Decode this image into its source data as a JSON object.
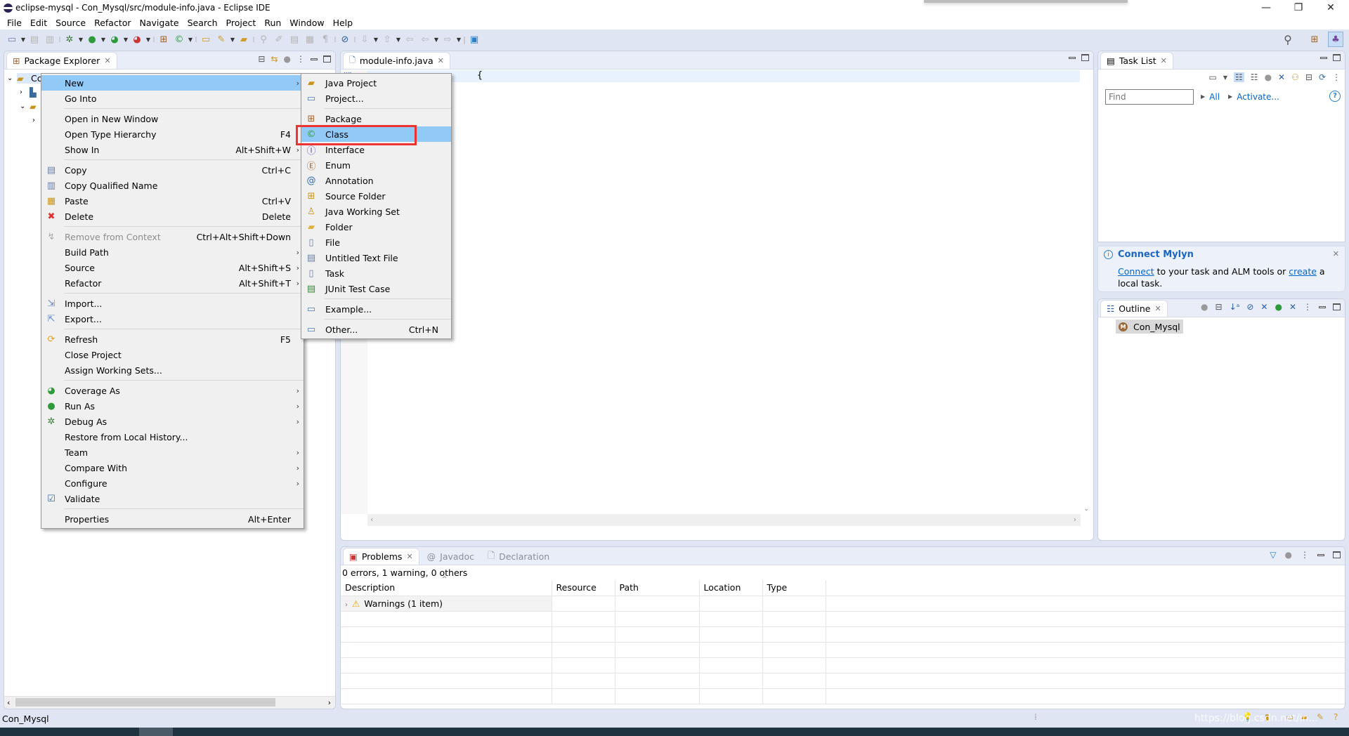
{
  "window": {
    "title": "eclipse-mysql - Con_Mysql/src/module-info.java - Eclipse IDE",
    "controls": {
      "minimize": "—",
      "restore": "❐",
      "close": "✕"
    }
  },
  "menubar": [
    "File",
    "Edit",
    "Source",
    "Refactor",
    "Navigate",
    "Search",
    "Project",
    "Run",
    "Window",
    "Help"
  ],
  "package_explorer": {
    "tab_label": "Package Explorer",
    "project_name_partial": "Cc",
    "tree": [
      {
        "name": "Cc",
        "icon": "java-project-icon",
        "expanded": true,
        "level": 0
      },
      {
        "name": "",
        "icon": "jre-library-icon",
        "expanded": false,
        "level": 1
      },
      {
        "name": "",
        "icon": "source-folder-icon",
        "expanded": true,
        "level": 1
      },
      {
        "name": "",
        "icon": "package-icon",
        "expanded": false,
        "level": 2
      }
    ]
  },
  "context_menu": {
    "items": [
      {
        "label": "New",
        "shortcut": "",
        "submenu": true,
        "selected": true,
        "icon": ""
      },
      {
        "label": "Go Into",
        "shortcut": ""
      },
      {
        "separator": true
      },
      {
        "label": "Open in New Window",
        "shortcut": ""
      },
      {
        "label": "Open Type Hierarchy",
        "shortcut": "F4"
      },
      {
        "label": "Show In",
        "shortcut": "Alt+Shift+W",
        "submenu": true
      },
      {
        "separator": true
      },
      {
        "label": "Copy",
        "shortcut": "Ctrl+C",
        "icon": "copy-icon"
      },
      {
        "label": "Copy Qualified Name",
        "shortcut": "",
        "icon": "copy-qualified-icon"
      },
      {
        "label": "Paste",
        "shortcut": "Ctrl+V",
        "icon": "paste-icon"
      },
      {
        "label": "Delete",
        "shortcut": "Delete",
        "icon": "delete-icon"
      },
      {
        "separator": true
      },
      {
        "label": "Remove from Context",
        "shortcut": "Ctrl+Alt+Shift+Down",
        "disabled": true,
        "icon": "remove-context-icon"
      },
      {
        "label": "Build Path",
        "shortcut": "",
        "submenu": true
      },
      {
        "label": "Source",
        "shortcut": "Alt+Shift+S",
        "submenu": true
      },
      {
        "label": "Refactor",
        "shortcut": "Alt+Shift+T",
        "submenu": true
      },
      {
        "separator": true
      },
      {
        "label": "Import...",
        "shortcut": "",
        "icon": "import-icon"
      },
      {
        "label": "Export...",
        "shortcut": "",
        "icon": "export-icon"
      },
      {
        "separator": true
      },
      {
        "label": "Refresh",
        "shortcut": "F5",
        "icon": "refresh-icon"
      },
      {
        "label": "Close Project",
        "shortcut": ""
      },
      {
        "label": "Assign Working Sets...",
        "shortcut": ""
      },
      {
        "separator": true
      },
      {
        "label": "Coverage As",
        "shortcut": "",
        "submenu": true,
        "icon": "coverage-icon"
      },
      {
        "label": "Run As",
        "shortcut": "",
        "submenu": true,
        "icon": "run-icon"
      },
      {
        "label": "Debug As",
        "shortcut": "",
        "submenu": true,
        "icon": "debug-icon"
      },
      {
        "label": "Restore from Local History...",
        "shortcut": ""
      },
      {
        "label": "Team",
        "shortcut": "",
        "submenu": true
      },
      {
        "label": "Compare With",
        "shortcut": "",
        "submenu": true
      },
      {
        "label": "Configure",
        "shortcut": "",
        "submenu": true
      },
      {
        "label": "Validate",
        "shortcut": "",
        "icon": "checkbox-checked-icon"
      },
      {
        "separator": true
      },
      {
        "label": "Properties",
        "shortcut": "Alt+Enter"
      }
    ]
  },
  "new_submenu": {
    "items": [
      {
        "label": "Java Project",
        "icon": "new-java-project-icon"
      },
      {
        "label": "Project...",
        "icon": "new-project-icon"
      },
      {
        "separator": true
      },
      {
        "label": "Package",
        "icon": "new-package-icon"
      },
      {
        "label": "Class",
        "icon": "new-class-icon",
        "selected": true,
        "highlighted_box": true
      },
      {
        "label": "Interface",
        "icon": "new-interface-icon"
      },
      {
        "label": "Enum",
        "icon": "new-enum-icon"
      },
      {
        "label": "Annotation",
        "icon": "new-annotation-icon"
      },
      {
        "label": "Source Folder",
        "icon": "new-source-folder-icon"
      },
      {
        "label": "Java Working Set",
        "icon": "new-working-set-icon"
      },
      {
        "label": "Folder",
        "icon": "new-folder-icon"
      },
      {
        "label": "File",
        "icon": "new-file-icon"
      },
      {
        "label": "Untitled Text File",
        "icon": "new-text-file-icon"
      },
      {
        "label": "Task",
        "icon": "new-task-icon"
      },
      {
        "label": "JUnit Test Case",
        "icon": "new-junit-icon"
      },
      {
        "separator": true
      },
      {
        "label": "Example...",
        "icon": "new-example-icon"
      },
      {
        "separator": true
      },
      {
        "label": "Other...",
        "shortcut": "Ctrl+N",
        "icon": "new-other-icon"
      }
    ],
    "highlight_color": "#ee3333"
  },
  "editor": {
    "tab_label": "module-info.java",
    "code_visible_fragment": "{"
  },
  "task_list": {
    "tab_label": "Task List",
    "find_placeholder": "Find",
    "all_link": "All",
    "activate_link": "Activate..."
  },
  "mylyn": {
    "title": "Connect Mylyn",
    "connect_link": "Connect",
    "text_mid": " to your task and ALM tools or ",
    "create_link": "create",
    "text_end": " a local task."
  },
  "outline": {
    "tab_label": "Outline",
    "item": "Con_Mysql"
  },
  "problems": {
    "tabs": [
      "Problems",
      "Javadoc",
      "Declaration"
    ],
    "summary": "0 errors, 1 warning, 0 others",
    "columns": [
      "Description",
      "Resource",
      "Path",
      "Location",
      "Type"
    ],
    "rows": [
      {
        "description": "Warnings (1 item)",
        "resource": "",
        "path": "",
        "location": "",
        "type": ""
      }
    ]
  },
  "status_bar": {
    "selected": "Con_Mysql",
    "watermark": "https://blog.csdn.net/in..."
  },
  "colors": {
    "accent_selection": "#91c9f7",
    "highlight_box": "#ee3333",
    "link": "#0066cc"
  }
}
